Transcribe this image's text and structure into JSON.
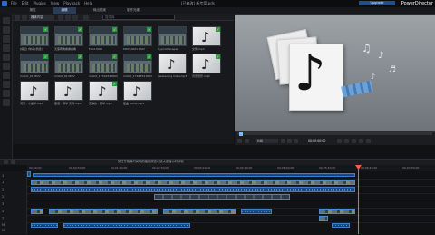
{
  "app": {
    "menu": [
      "File",
      "Edit",
      "Plugins",
      "View",
      "Playback",
      "Help"
    ],
    "doc_title": "(已修改) 新专案.pds",
    "upgrade_label": "Upgrade",
    "brand": "PowerDirector"
  },
  "mode_tabs": [
    "捕捉",
    "编辑",
    "输出档案",
    "制作光碟"
  ],
  "library": {
    "dropdown": "媒体内容",
    "search_placeholder": "搜寻库",
    "items": [
      {
        "label": "[保卫] 你好 [视频]",
        "kind": "vid"
      },
      {
        "label": "无需再看看看看看",
        "kind": "vid"
      },
      {
        "label": "Food.MOV",
        "kind": "vid"
      },
      {
        "label": "MOV_0001.MOV",
        "kind": "vid"
      },
      {
        "label": "Hypnotherapie",
        "kind": "vid"
      },
      {
        "label": "文件.mp3",
        "kind": "music"
      },
      {
        "label": "mixkit_01.MOV",
        "kind": "vid"
      },
      {
        "label": "mixkit_02.MOV",
        "kind": "vid"
      },
      {
        "label": "mixkit_1751054.MOV",
        "kind": "vid"
      },
      {
        "label": "mixkit_1748354.MOV",
        "kind": "vid"
      },
      {
        "label": "Awakening Insta.mp3",
        "kind": "music"
      },
      {
        "label": "背景音乐.mp3",
        "kind": "music"
      },
      {
        "label": "河流 - 小提琴.mp3",
        "kind": "music"
      },
      {
        "label": "童话 - 钢琴 无词.mp3",
        "kind": "music"
      },
      {
        "label": "安静的 - 钢琴.mp3",
        "kind": "music"
      },
      {
        "label": "夜曲 remix.mp3",
        "kind": "music"
      }
    ]
  },
  "transport": {
    "clip_mode": "片段",
    "timecode": "00;00;00;00"
  },
  "timeline": {
    "hint": "按住并拖曳时间轴的缩放按钮以放大或缩小时间轴",
    "ruler": [
      "00;00;00",
      "00;00;50;00",
      "00;01;40;00",
      "00;02;30;00",
      "00;03;20;00",
      "00;04;10;00",
      "00;05;00;00",
      "00;05;50;00",
      "00;06;40;00",
      "00;07;30;00"
    ],
    "tracks": [
      "1",
      "1",
      "2",
      "2",
      "3",
      "3",
      "T",
      "M",
      "M"
    ]
  }
}
